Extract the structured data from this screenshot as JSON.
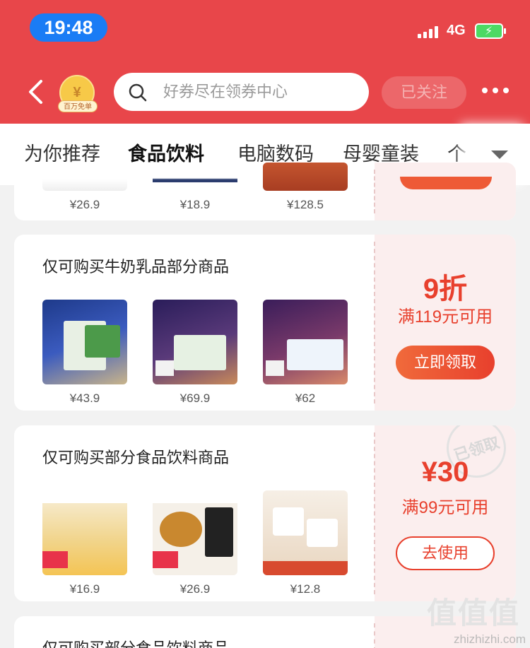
{
  "status_bar": {
    "time": "19:48",
    "network": "4G"
  },
  "header": {
    "badge_text": "百万免单",
    "search_placeholder": "好券尽在领券中心",
    "follow_label": "已关注"
  },
  "tabs": [
    {
      "label": "为你推荐"
    },
    {
      "label": "食品饮料"
    },
    {
      "label": "电脑数码"
    },
    {
      "label": "母婴童装"
    },
    {
      "label": "个"
    }
  ],
  "active_tab": "食品饮料",
  "coupons": [
    {
      "title": "",
      "products": [
        {
          "price": "¥26.9"
        },
        {
          "price": "¥18.9"
        },
        {
          "price": "¥128.5"
        }
      ]
    },
    {
      "title": "仅可购买牛奶乳品部分商品",
      "discount": "9折",
      "condition": "满119元可用",
      "button": "立即领取",
      "products": [
        {
          "price": "¥43.9"
        },
        {
          "price": "¥69.9"
        },
        {
          "price": "¥62"
        }
      ]
    },
    {
      "title": "仅可购买部分食品饮料商品",
      "discount": "¥30",
      "condition": "满99元可用",
      "button": "去使用",
      "stamp": "已领取",
      "products": [
        {
          "price": "¥16.9"
        },
        {
          "price": "¥26.9"
        },
        {
          "price": "¥12.8"
        }
      ]
    },
    {
      "title": "仅可购买部分食品饮料商品"
    }
  ],
  "watermark": {
    "chars": "值值值",
    "url": "zhizhizhi.com"
  },
  "colors": {
    "header_bg": "#e8464a",
    "accent": "#e8402d",
    "coupon_side_bg": "#fbeeee"
  }
}
